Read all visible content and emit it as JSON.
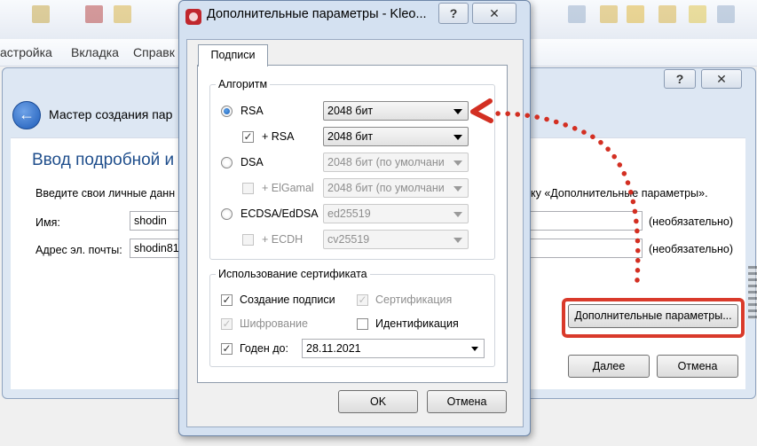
{
  "app": {
    "menu": [
      "астройка",
      "Вкладка",
      "Справк"
    ]
  },
  "wizard": {
    "title": "Мастер создания пар",
    "heading": "Ввод подробной и",
    "description_left": "Введите свои личные данн",
    "description_right": "ку «Дополнительные параметры».",
    "name_label": "Имя:",
    "name_value": "shodin",
    "email_label": "Адрес эл. почты:",
    "email_value": "shodin81",
    "optional_1": "(необязательно)",
    "optional_2": "(необязательно)",
    "advanced_button": "Дополнительные параметры...",
    "next_button": "Далее",
    "cancel_button": "Отмена",
    "help_caption": "?",
    "close_caption": "✕"
  },
  "dialog": {
    "title": "Дополнительные параметры - Kleo...",
    "help_caption": "?",
    "close_caption": "✕",
    "tab": "Подписи",
    "algorithm_group": "Алгоритм",
    "algorithms": [
      {
        "label": "RSA",
        "value": "2048 бит",
        "checked": true
      },
      {
        "label": "+ RSA",
        "value": "2048 бит",
        "checked": true
      },
      {
        "label": "DSA",
        "value": "2048 бит (по умолчани"
      },
      {
        "label": "+ ElGamal",
        "value": "2048 бит (по умолчани"
      },
      {
        "label": "ECDSA/EdDSA",
        "value": "ed25519"
      },
      {
        "label": "+ ECDH",
        "value": "cv25519"
      }
    ],
    "usage_group": "Использование сертификата",
    "usage": {
      "signing": "Создание подписи",
      "certification": "Сертификация",
      "encryption": "Шифрование",
      "authentication": "Идентификация",
      "valid_until": "Годен до:",
      "date": "28.11.2021"
    },
    "ok_button": "OK",
    "cancel_button": "Отмена"
  },
  "colors": {
    "highlight": "#d93a2b",
    "heading": "#1f4e8c"
  }
}
